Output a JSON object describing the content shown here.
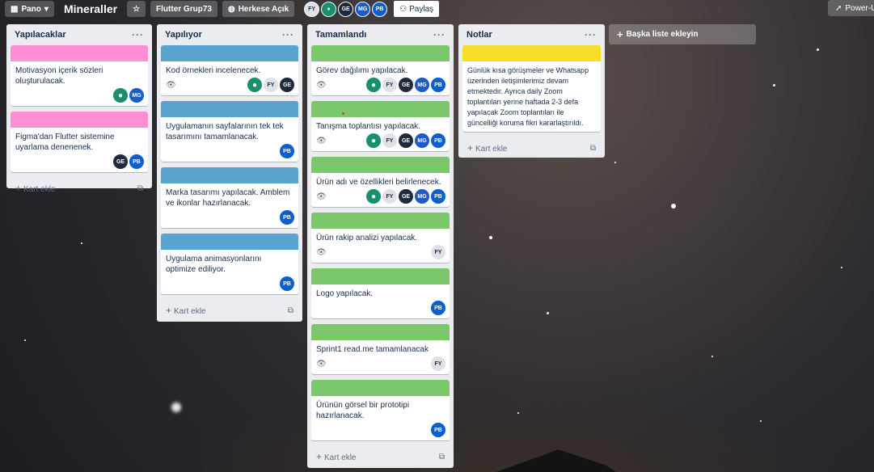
{
  "header": {
    "board_menu_label": "Pano",
    "board_title": "Mineraller",
    "team_label": "Flutter Grup73",
    "visibility_label": "Herkese Açık",
    "members": [
      "FY",
      "",
      "GE",
      "MG",
      "PB"
    ],
    "share_label": "Paylaş",
    "powerup_label": "Power-Up"
  },
  "lists": [
    {
      "title": "Yapılacaklar",
      "add_card": "Kart ekle",
      "cards": [
        {
          "text": "Motivasyon içerik sözleri oluşturulacak.",
          "avatars": [
            "",
            "MG"
          ]
        },
        {
          "text": "Figma'dan Flutter sistemine uyarlama denenenek.",
          "avatars": [
            "GE",
            "PB"
          ]
        }
      ]
    },
    {
      "title": "Yapılıyor",
      "add_card": "Kart ekle",
      "cards": [
        {
          "text": "Kod örnekleri incelenecek.",
          "avatars": [
            "",
            "FY",
            "GE"
          ]
        },
        {
          "text": "Uygulamanın sayfalarının tek tek tasarımını tamamlanacak.",
          "avatars": [
            "PB"
          ]
        },
        {
          "text": "Marka tasarımı yapılacak. Amblem ve ikonlar hazırlanacak.",
          "avatars": [
            "PB"
          ]
        },
        {
          "text": "Uygulama animasyonlarını optimize ediliyor.",
          "avatars": [
            "PB"
          ]
        }
      ]
    },
    {
      "title": "Tamamlandı",
      "add_card": "Kart ekle",
      "cards": [
        {
          "text": "Görev dağılımı yapılacak.",
          "avatars": [
            "",
            "FY",
            "GE",
            "MG",
            "PB"
          ]
        },
        {
          "text": "Tanışma toplantısı yapılacak.",
          "avatars": [
            "",
            "FY",
            "GE",
            "MG",
            "PB"
          ]
        },
        {
          "text": "Ürün adı ve özellikleri belirlenecek.",
          "avatars": [
            "",
            "FY",
            "GE",
            "MG",
            "PB"
          ]
        },
        {
          "text": "Ürün rakip analizi yapılacak.",
          "avatars": [
            "FY"
          ]
        },
        {
          "text": "Logo yapılacak.",
          "avatars": [
            "PB"
          ]
        },
        {
          "text": "Sprint1 read.me tamamlanacak",
          "avatars": [
            "FY"
          ]
        },
        {
          "text": "Ürünün görsel bir prototipi hazırlanacak.",
          "avatars": [
            "PB"
          ]
        }
      ]
    },
    {
      "title": "Notlar",
      "add_card": "Kart ekle",
      "cards": [
        {
          "text": "Günlük kısa görüşmeler ve Whatsapp üzerinden iletişimlerimiz devam etmektedir. Ayrıca daily Zoom toplantıları yerine haftada 2-3 defa yapılacak Zoom toplantıları ile güncelliği koruma fikri kararlaştırıldı.",
          "avatars": []
        }
      ]
    }
  ],
  "add_list_label": "Başka liste ekleyin",
  "colors": {
    "pink": "#ff8ed4",
    "blue": "#5ba4cf",
    "green": "#7bc86c",
    "yellow": "#f5dd29"
  }
}
